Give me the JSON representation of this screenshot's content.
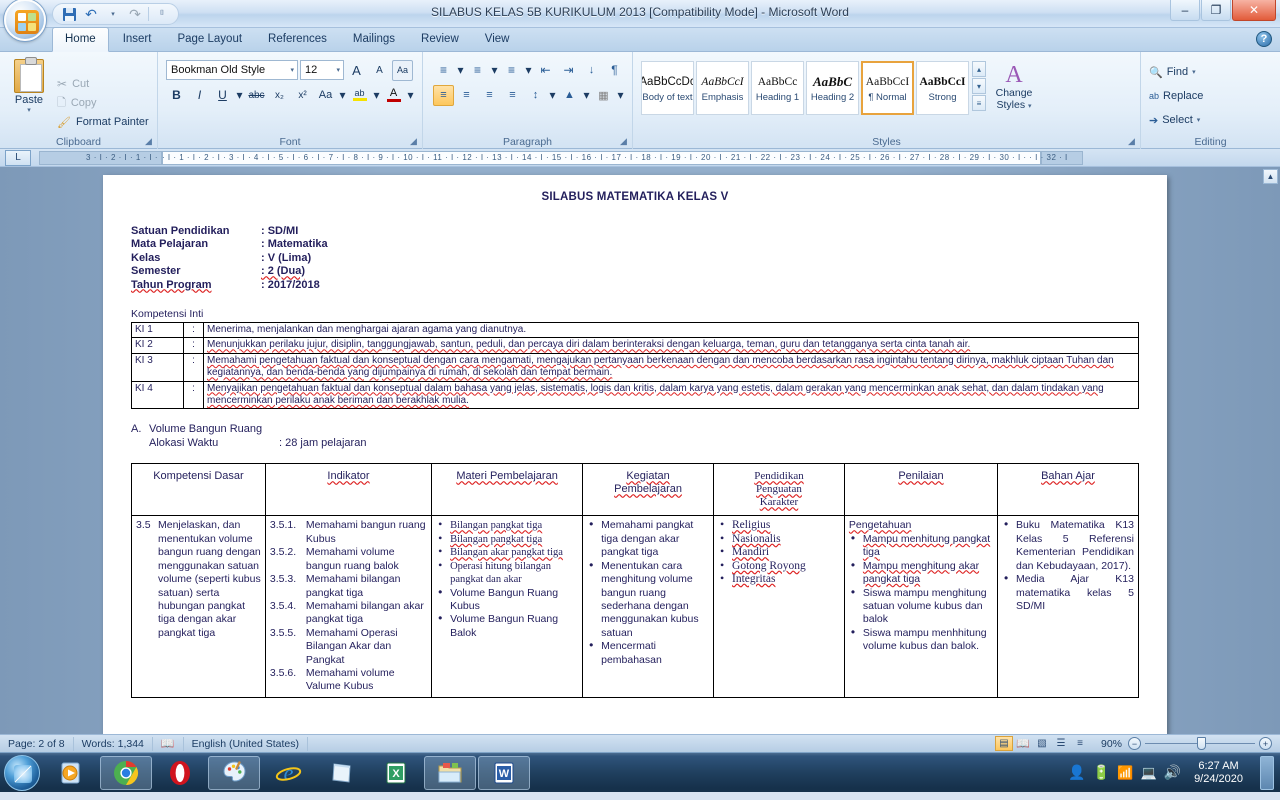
{
  "window": {
    "title": "SILABUS KELAS 5B KURIKULUM 2013 [Compatibility Mode]  -  Microsoft Word",
    "minimize": "–",
    "restore": "❐",
    "close": "✕"
  },
  "quick_access": {
    "save": "save-icon",
    "undo": "↶",
    "redo": "↷",
    "more": "⌵"
  },
  "tabs": [
    {
      "label": "Home",
      "active": true
    },
    {
      "label": "Insert",
      "active": false
    },
    {
      "label": "Page Layout",
      "active": false
    },
    {
      "label": "References",
      "active": false
    },
    {
      "label": "Mailings",
      "active": false
    },
    {
      "label": "Review",
      "active": false
    },
    {
      "label": "View",
      "active": false
    }
  ],
  "help_button": "?",
  "ribbon": {
    "clipboard": {
      "group_label": "Clipboard",
      "paste_label": "Paste",
      "paste_arrow": "▾",
      "cut_label": "Cut",
      "copy_label": "Copy",
      "format_painter_label": "Format Painter"
    },
    "font": {
      "group_label": "Font",
      "font_name": "Bookman Old Style",
      "font_size": "12",
      "grow_font": "A",
      "shrink_font": "A",
      "clear_formatting": "Aa",
      "bold": "B",
      "italic": "I",
      "underline": "U",
      "strikethrough": "abc",
      "subscript": "x₂",
      "superscript": "x²",
      "change_case": "Aa",
      "highlight": "ab",
      "font_color": "A"
    },
    "paragraph": {
      "group_label": "Paragraph",
      "bullets": "≡",
      "numbering": "≡",
      "multilevel": "≡",
      "decrease_indent": "←≡",
      "increase_indent": "≡→",
      "sort": "A↓",
      "show_marks": "¶",
      "align_left": "≡",
      "align_center": "≡",
      "align_right": "≡",
      "justify": "≡",
      "line_spacing": "↕≡",
      "shading": "△",
      "borders": "▦"
    },
    "styles": {
      "group_label": "Styles",
      "items": [
        {
          "preview": "AaBbCcDc",
          "name": "Body of text",
          "active": false,
          "style": "normal"
        },
        {
          "preview": "AaBbCcI",
          "name": "Emphasis",
          "active": false,
          "style": "italic"
        },
        {
          "preview": "AaBbCc",
          "name": "Heading 1",
          "active": false,
          "style": "normal"
        },
        {
          "preview": "AaBbC",
          "name": "Heading 2",
          "active": false,
          "style": "bolditalic"
        },
        {
          "preview": "AaBbCcI",
          "name": "¶ Normal",
          "active": true,
          "style": "normal"
        },
        {
          "preview": "AaBbCcI",
          "name": "Strong",
          "active": false,
          "style": "bold"
        }
      ],
      "scroll_up": "▴",
      "scroll_down": "▾",
      "more": "≡",
      "change_styles": "Change\nStyles",
      "change_styles_label": "Change Styles",
      "change_styles_arrow": "▾"
    },
    "editing": {
      "group_label": "Editing",
      "find": "Find",
      "replace": "Replace",
      "select": "Select",
      "arrow": "▾"
    }
  },
  "ruler": {
    "left_numbers": "3 · I · 2 · I · 1 · I ·",
    "right_numbers": "· I · 1 · I · 2 · I · 3 · I · 4 · I · 5 · I · 6 · I · 7 · I · 8 · I · 9 · I · 10 · I · 11 · I · 12 · I · 13 · I · 14 · I · 15 · I · 16 · I · 17 · I · 18 · I · 19 · I · 20 · I · 21 · I · 22 · I · 23 · I · 24 · I · 25 · I · 26 · I · 27 · I · 28 · I · 29 · I · 30 · I ·  · I · 32 · I",
    "corner_tab": "L"
  },
  "document": {
    "title": "SILABUS MATEMATIKA KELAS V",
    "meta": [
      {
        "key": "Satuan Pendidikan",
        "value": ": SD/MI"
      },
      {
        "key": "Mata Pelajaran",
        "value": ": Matematika"
      },
      {
        "key": "Kelas",
        "value": ": V (Lima)"
      },
      {
        "key": "Semester",
        "value": ": 2 (Dua)"
      },
      {
        "key": "Tahun Program",
        "value": ": 2017/2018"
      }
    ],
    "ki_label": "Kompetensi Inti",
    "ki_rows": [
      {
        "code": "KI 1",
        "sep": ":",
        "text": "Menerima, menjalankan dan menghargai ajaran agama yang dianutnya."
      },
      {
        "code": "KI 2",
        "sep": ":",
        "text": "Menunjukkan perilaku jujur, disiplin, tanggungjawab, santun, peduli, dan percaya diri dalam berinteraksi dengan keluarga, teman, guru dan tetangganya serta cinta tanah air."
      },
      {
        "code": "KI 3",
        "sep": ":",
        "text": "Memahami pengetahuan faktual dan konseptual dengan cara mengamati, mengajukan pertanyaan berkenaan dengan dan mencoba berdasarkan rasa ingintahu tentang dirinya, makhluk ciptaan Tuhan dan kegiatannya, dan benda-benda yang dijumpainya di rumah, di sekolah dan tempat bermain."
      },
      {
        "code": "KI 4",
        "sep": ":",
        "text": "Menyajikan pengetahuan faktual dan konseptual dalam bahasa yang jelas, sistematis, logis dan kritis, dalam karya yang estetis, dalam gerakan yang mencerminkan anak sehat, dan dalam tindakan yang mencerminkan perilaku anak beriman dan berakhlak mulia."
      }
    ],
    "section": {
      "letter": "A.",
      "title": "Volume Bangun Ruang",
      "alokasi_key": "Alokasi Waktu",
      "alokasi_value": ": 28 jam pelajaran"
    },
    "table": {
      "headers": [
        "Kompetensi Dasar",
        "Indikator",
        "Materi Pembelajaran",
        "Kegiatan\nPembelajaran",
        "Pendidikan\nPenguatan\nKarakter",
        "Penilaian",
        "Bahan Ajar"
      ],
      "row": {
        "kompetensi_dasar": {
          "number": "3.5",
          "text": "Menjelaskan, dan menentukan volume bangun ruang dengan menggunakan satuan volume (seperti kubus satuan) serta hubungan pangkat tiga dengan akar pangkat tiga"
        },
        "indikator": [
          {
            "n": "3.5.1.",
            "t": "Memahami bangun ruang Kubus"
          },
          {
            "n": "3.5.2.",
            "t": "Memahami volume bangun ruang balok"
          },
          {
            "n": "3.5.3.",
            "t": "Memahami bilangan pangkat tiga"
          },
          {
            "n": "3.5.4.",
            "t": "Memahami bilangan akar pangkat tiga"
          },
          {
            "n": "3.5.5.",
            "t": "Memahami Operasi Bilangan Akar dan Pangkat"
          },
          {
            "n": "3.5.6.",
            "t": "Memahami volume Valume Kubus"
          }
        ],
        "materi": [
          {
            "t": "Bilangan pangkat tiga",
            "serif": true
          },
          {
            "t": "Bilangan pangkat tiga",
            "serif": true
          },
          {
            "t": "Bilangan akar pangkat tiga",
            "serif": true
          },
          {
            "t": "Operasi hitung bilangan pangkat dan akar",
            "serif": true
          },
          {
            "t": "Volume Bangun Ruang Kubus",
            "serif": false
          },
          {
            "t": "Volume Bangun Ruang Balok",
            "serif": false
          }
        ],
        "kegiatan": [
          "Memahami pangkat tiga dengan akar pangkat tiga",
          "Menentukan cara menghitung volume bangun ruang sederhana dengan menggunakan kubus satuan",
          "Mencermati pembahasan"
        ],
        "ppk": [
          "Religius",
          "Nasionalis",
          "Mandiri",
          "Gotong Royong",
          "Integritas"
        ],
        "penilaian": {
          "heading": "Pengetahuan",
          "items": [
            "Mampu menhitung pangkat tiga",
            "Mampu menghitung akar pangkat tiga",
            "Siswa mampu menghitung satuan volume kubus dan balok",
            "Siswa mampu menhhitung volume kubus dan balok."
          ]
        },
        "bahan_ajar": [
          "Buku Matematika K13 Kelas 5 Referensi Kementerian Pendidikan dan Kebudayaan, 2017).",
          "Media Ajar K13 matematika kelas 5 SD/MI"
        ]
      }
    }
  },
  "statusbar": {
    "page": "Page: 2 of 8",
    "words": "Words: 1,344",
    "language": "English (United States)",
    "proof_icon": "spellcheck-icon",
    "views": [
      {
        "name": "print-layout",
        "glyph": "▤",
        "active": true
      },
      {
        "name": "full-screen-reading",
        "glyph": "Ὅ6",
        "active": false
      },
      {
        "name": "web-layout",
        "glyph": "▧",
        "active": false
      },
      {
        "name": "outline",
        "glyph": "☰",
        "active": false
      },
      {
        "name": "draft",
        "glyph": "≡",
        "active": false
      }
    ],
    "zoom": "90%",
    "zoom_out": "−",
    "zoom_in": "+"
  },
  "taskbar": {
    "start": "start-orb",
    "items": [
      {
        "name": "media-player",
        "framed": false
      },
      {
        "name": "google-chrome",
        "framed": true
      },
      {
        "name": "opera-browser",
        "framed": false
      },
      {
        "name": "paint",
        "framed": true
      },
      {
        "name": "internet-explorer",
        "framed": false
      },
      {
        "name": "notepad",
        "framed": false
      },
      {
        "name": "excel",
        "framed": false
      },
      {
        "name": "file-explorer",
        "framed": true
      },
      {
        "name": "microsoft-word",
        "framed": true
      }
    ],
    "tray": [
      "user-icon",
      "battery-icon",
      "signal-icon",
      "network-icon",
      "volume-icon"
    ],
    "time": "6:27 AM",
    "date": "9/24/2020"
  }
}
